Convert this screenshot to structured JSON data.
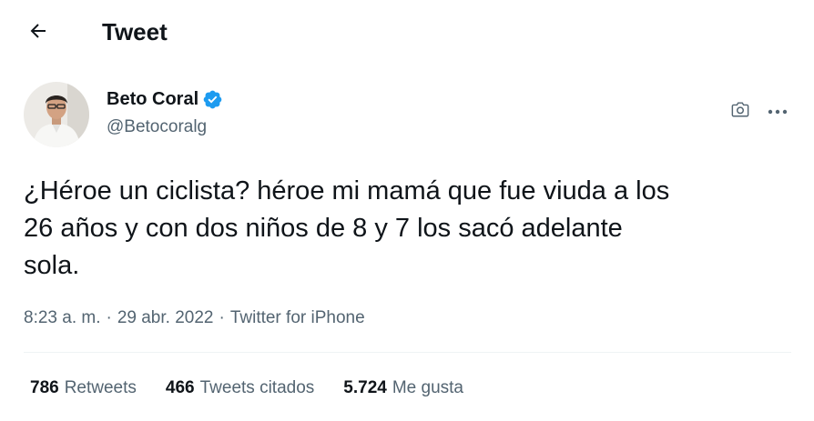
{
  "header": {
    "title": "Tweet",
    "back_icon": "arrow-left-icon"
  },
  "author": {
    "name": "Beto Coral",
    "handle": "@Betocoralg",
    "verified_icon": "verified-badge-icon",
    "verified_color": "#1d9bf0"
  },
  "actions": {
    "camera_icon": "camera-icon",
    "more_icon": "more-dots-icon"
  },
  "tweet": {
    "text": "¿Héroe un ciclista? héroe mi mamá que fue viuda a los\n26 años y con dos niños de 8 y 7 los sacó adelante\nsola."
  },
  "meta": {
    "time": "8:23 a. m.",
    "separator": "·",
    "date": "29 abr. 2022",
    "source": "Twitter for iPhone"
  },
  "stats": {
    "retweets_count": "786",
    "retweets_label": "Retweets",
    "quotes_count": "466",
    "quotes_label": "Tweets citados",
    "likes_count": "5.724",
    "likes_label": "Me gusta"
  }
}
